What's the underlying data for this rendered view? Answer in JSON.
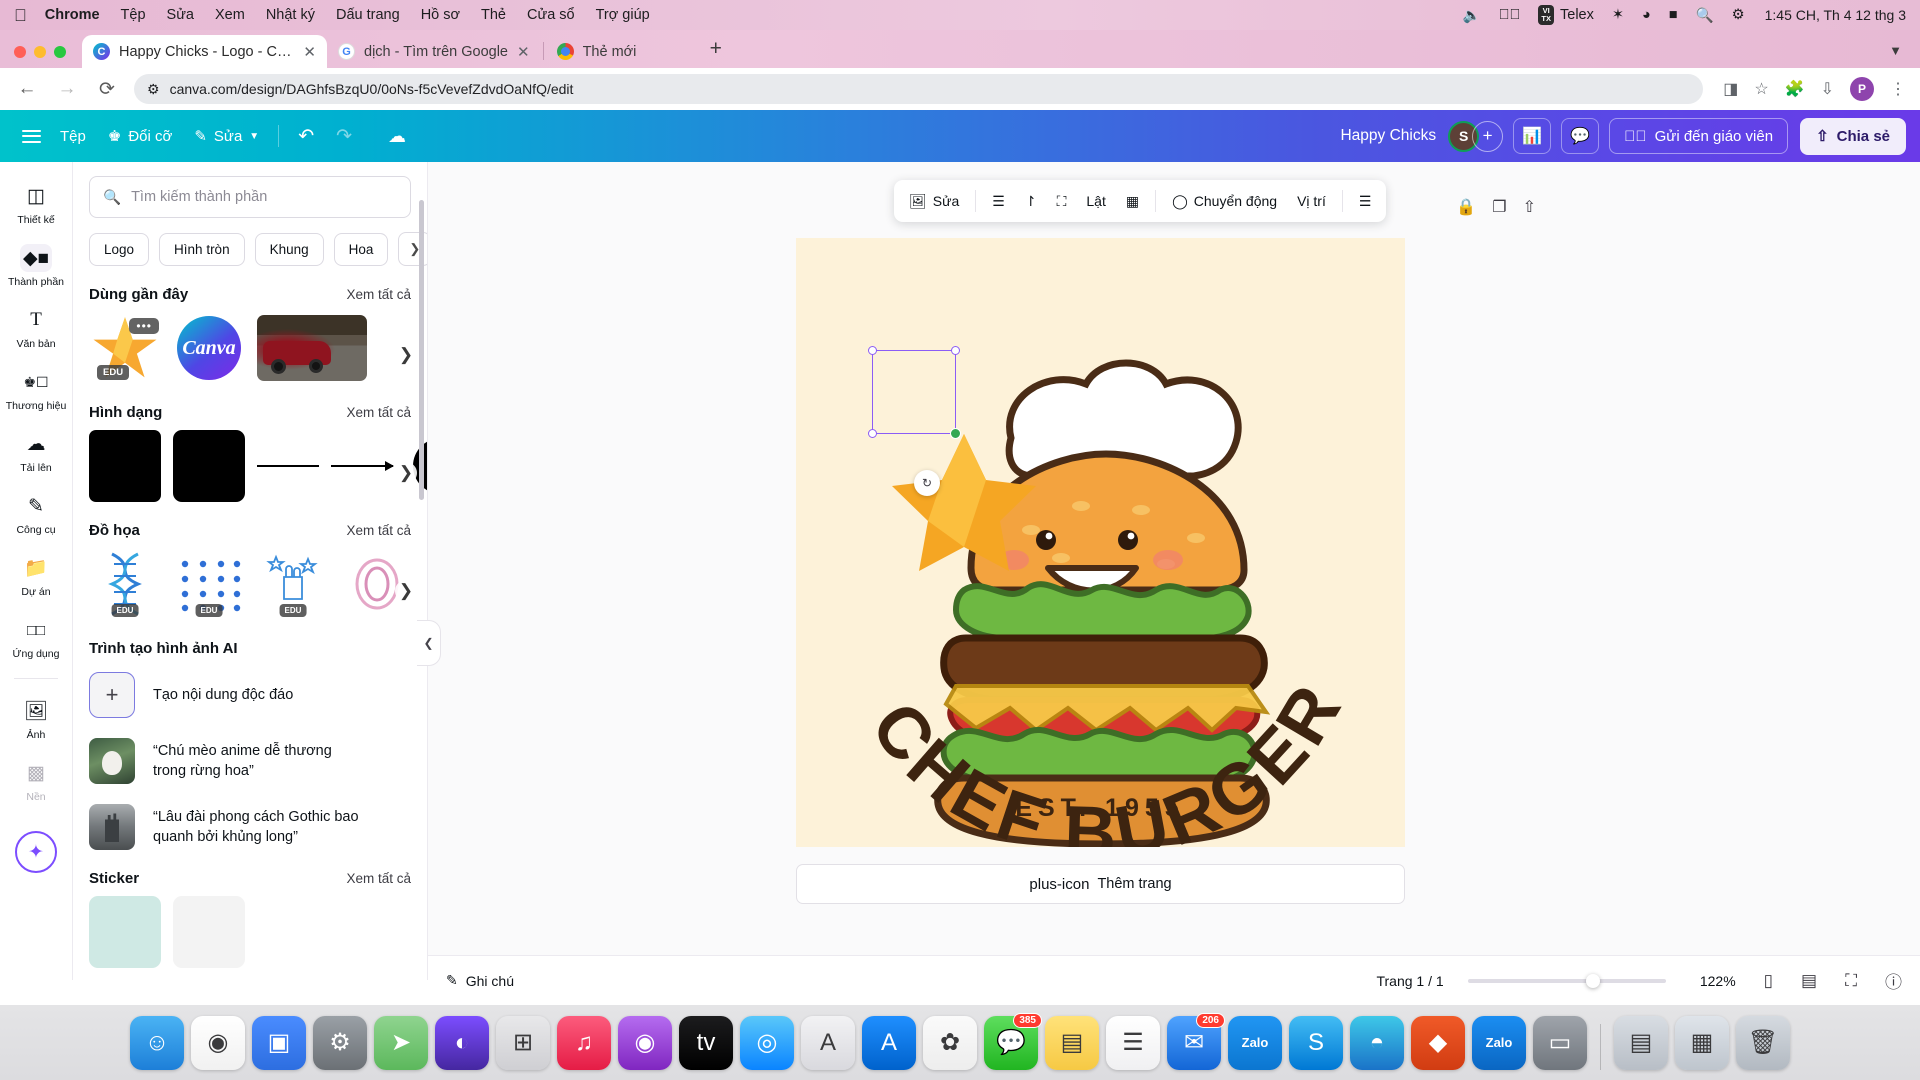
{
  "macbar": {
    "apple_icon": "apple-icon",
    "items": [
      "Chrome",
      "Tệp",
      "Sửa",
      "Xem",
      "Nhật ký",
      "Dấu trang",
      "Hồ sơ",
      "Thẻ",
      "Cửa sổ",
      "Trợ giúp"
    ],
    "right": {
      "volume_icon": "volume-icon",
      "control_icon": "play-circle-icon",
      "telex_badge": "VI TX",
      "telex_label": "Telex",
      "bluetooth_icon": "bluetooth-icon",
      "wifi_icon": "wifi-icon",
      "battery_icon": "battery-icon",
      "search_icon": "search-icon",
      "controlcenter_icon": "control-center-icon",
      "clock": "1:45 CH, Th 4 12 thg 3"
    }
  },
  "browser": {
    "tabs": [
      {
        "title": "Happy Chicks - Logo - Canva",
        "favicon": "canva-icon",
        "active": true,
        "close": "✕"
      },
      {
        "title": "dịch - Tìm trên Google",
        "favicon": "google-icon",
        "active": false,
        "close": "✕"
      },
      {
        "title": "Thẻ mới",
        "favicon": "chrome-icon",
        "active": false,
        "close": "✕"
      }
    ],
    "new_tab_label": "+",
    "tabstrip_chevron": "chevron-down-icon",
    "nav": {
      "back": "←",
      "forward": "→",
      "reload": "⟳"
    },
    "url": "canva.com/design/DAGhfsBzqU0/0oNs-f5cVevefZdvdOaNfQ/edit",
    "url_lock_icon": "site-settings-icon",
    "toolbar_icons": [
      "split-view-icon",
      "bookmark-star-icon",
      "extensions-icon",
      "download-icon"
    ],
    "profile_initial": "P",
    "menu_icon": "kebab-menu-icon"
  },
  "canva_top": {
    "menu_icon": "hamburger-icon",
    "file_label": "Tệp",
    "resize_label": "Đổi cỡ",
    "resize_icon": "crown-icon",
    "edit_label": "Sửa",
    "edit_icon": "pencil-icon",
    "edit_chevron": "chevron-down-icon",
    "undo_icon": "undo-icon",
    "redo_icon": "redo-icon",
    "cloud_icon": "cloud-saved-icon",
    "doc_name": "Happy Chicks",
    "avatar_initial": "S",
    "add_people": "+",
    "insights_icon": "bar-chart-icon",
    "comment_icon": "comment-icon",
    "submit_label": "Gửi đến giáo viên",
    "submit_icon": "check-circle-icon",
    "share_label": "Chia sẻ",
    "share_icon": "upload-icon"
  },
  "rail": {
    "items": [
      {
        "label": "Thiết kế",
        "icon": "design-layout-icon",
        "selected": false
      },
      {
        "label": "Thành phần",
        "icon": "elements-shapes-icon",
        "selected": true
      },
      {
        "label": "Văn bản",
        "icon": "text-T-icon",
        "selected": false
      },
      {
        "label": "Thương hiệu",
        "icon": "brand-crown-icon",
        "selected": false
      },
      {
        "label": "Tải lên",
        "icon": "upload-cloud-icon",
        "selected": false
      },
      {
        "label": "Công cụ",
        "icon": "tools-draw-icon",
        "selected": false
      },
      {
        "label": "Dự án",
        "icon": "folder-icon",
        "selected": false
      },
      {
        "label": "Ứng dụng",
        "icon": "apps-grid-icon",
        "selected": false
      },
      {
        "label": "Ảnh",
        "icon": "photo-icon",
        "selected": false
      },
      {
        "label": "Nền",
        "icon": "background-pattern-icon",
        "selected": false,
        "dim": true
      }
    ],
    "magic_icon": "magic-sparkle-icon"
  },
  "panel": {
    "search": {
      "placeholder": "Tìm kiếm thành phần",
      "icon": "search-icon"
    },
    "chips": [
      "Logo",
      "Hình tròn",
      "Khung",
      "Hoa"
    ],
    "chip_more_icon": "chevron-right-icon",
    "see_all_label": "Xem tất cả",
    "sections": [
      {
        "title": "Dùng gần đây"
      },
      {
        "title": "Hình dạng"
      },
      {
        "title": "Đồ họa"
      },
      {
        "title": "Sticker"
      }
    ],
    "recent": {
      "star_badge_dots": "•••",
      "star_badge_edu": "EDU",
      "canva_logo_text": "Canva"
    },
    "ai_section": {
      "title": "Trình tạo hình ảnh AI",
      "create_label": "Tạo nội dung độc đáo",
      "prompts": [
        "“Chú mèo anime dễ thương trong rừng hoa”",
        "“Lâu đài phong cách Gothic bao quanh bởi khủng long”"
      ]
    },
    "collapse_icon": "chevron-left-icon"
  },
  "float_toolbar": {
    "items": [
      {
        "label": "Sửa",
        "icon": "image-edit-icon"
      },
      {
        "label": "",
        "icon": "lines-icon"
      },
      {
        "label": "",
        "icon": "curve-icon"
      },
      {
        "label": "",
        "icon": "crop-icon"
      },
      {
        "label": "Lật",
        "icon": "flip-icon"
      },
      {
        "label": "",
        "icon": "transparency-icon"
      },
      {
        "label": "Chuyển động",
        "icon": "animate-icon"
      },
      {
        "label": "Vị trí",
        "icon": "position-icon"
      },
      {
        "label": "",
        "icon": "filter-adjust-icon"
      }
    ]
  },
  "object_icons": [
    "lock-icon",
    "duplicate-icon",
    "share-object-icon"
  ],
  "canvas": {
    "logo": {
      "curved_text": "CHEF BURGER",
      "est_text": "EST. 1955",
      "background_color": "#fdf2d9",
      "accent_color": "#f5a623"
    },
    "add_page_label": "Thêm trang",
    "add_page_icon": "plus-icon",
    "rotate_icon": "rotate-icon"
  },
  "bottom": {
    "notes_label": "Ghi chú",
    "notes_icon": "notes-icon",
    "page_label": "Trang 1 / 1",
    "zoom_value": "122%",
    "icons": [
      "duplicate-page-icon",
      "grid-view-icon",
      "fullscreen-icon",
      "help-icon"
    ]
  },
  "dock": {
    "items": [
      {
        "name": "finder",
        "glyph": "☺",
        "color1": "#4ab3f4",
        "color2": "#1d7fd8",
        "badge": null
      },
      {
        "name": "chrome",
        "glyph": "◉",
        "color1": "#ffffff",
        "color2": "#f1f1f1",
        "badge": null
      },
      {
        "name": "zoom",
        "glyph": "▣",
        "color1": "#4a8cff",
        "color2": "#2d6ee0",
        "badge": null
      },
      {
        "name": "settings",
        "glyph": "⚙",
        "color1": "#9aa0a6",
        "color2": "#6b7075",
        "badge": null
      },
      {
        "name": "maps",
        "glyph": "➤",
        "color1": "#8fd48f",
        "color2": "#5cb85c",
        "badge": null
      },
      {
        "name": "photos-purple",
        "glyph": "◐",
        "color1": "#7c4dff",
        "color2": "#4527a0",
        "badge": null
      },
      {
        "name": "launchpad",
        "glyph": "⊞",
        "color1": "#e8e8ea",
        "color2": "#cfcfd3",
        "badge": null
      },
      {
        "name": "music",
        "glyph": "♫",
        "color1": "#fc5c7d",
        "color2": "#e51c45",
        "badge": null
      },
      {
        "name": "podcasts",
        "glyph": "◉",
        "color1": "#b56cf0",
        "color2": "#8026c0",
        "badge": null
      },
      {
        "name": "tv",
        "glyph": "tv",
        "color1": "#1c1c1e",
        "color2": "#000000",
        "badge": null
      },
      {
        "name": "safari",
        "glyph": "◎",
        "color1": "#5ac8fa",
        "color2": "#0a84ff",
        "badge": null
      },
      {
        "name": "fonts",
        "glyph": "A",
        "color1": "#f2f2f4",
        "color2": "#d9d9de",
        "badge": null
      },
      {
        "name": "appstore",
        "glyph": "A",
        "color1": "#1f8fff",
        "color2": "#0062cc",
        "badge": null
      },
      {
        "name": "photos",
        "glyph": "✿",
        "color1": "#fafafa",
        "color2": "#ededed",
        "badge": null
      },
      {
        "name": "messages",
        "glyph": "💬",
        "color1": "#5ede5e",
        "color2": "#21b521",
        "badge": "385"
      },
      {
        "name": "notes",
        "glyph": "▤",
        "color1": "#ffe27a",
        "color2": "#f6c944",
        "badge": null
      },
      {
        "name": "reminders",
        "glyph": "☰",
        "color1": "#ffffff",
        "color2": "#f0f0f2",
        "badge": null
      },
      {
        "name": "mail",
        "glyph": "✉",
        "color1": "#4fa3ff",
        "color2": "#1366d6",
        "badge": "206"
      },
      {
        "name": "zalo",
        "glyph": "Zalo",
        "color1": "#2196f3",
        "color2": "#0b76d0",
        "badge": null
      },
      {
        "name": "skype",
        "glyph": "S",
        "color1": "#43bdf4",
        "color2": "#0078d4",
        "badge": null
      },
      {
        "name": "edge",
        "glyph": "◓",
        "color1": "#3ec8e8",
        "color2": "#1a73c8",
        "badge": null
      },
      {
        "name": "vscode",
        "glyph": "◆",
        "color1": "#f05a28",
        "color2": "#d13c12",
        "badge": null
      },
      {
        "name": "zalo-pc",
        "glyph": "Zalo",
        "color1": "#1b8ef2",
        "color2": "#0a66c2",
        "badge": null
      },
      {
        "name": "screenshot",
        "glyph": "▭",
        "color1": "#9fa4ab",
        "color2": "#70767d",
        "badge": null
      },
      {
        "name": "folder-docs",
        "glyph": "▤",
        "color1": "#d8dde3",
        "color2": "#b8bec6",
        "badge": null
      },
      {
        "name": "folder-files",
        "glyph": "▦",
        "color1": "#dfe4ea",
        "color2": "#bec5cd",
        "badge": null
      },
      {
        "name": "trash",
        "glyph": "🗑",
        "color1": "#d5dae0",
        "color2": "#b2b9c1",
        "badge": null
      }
    ]
  }
}
